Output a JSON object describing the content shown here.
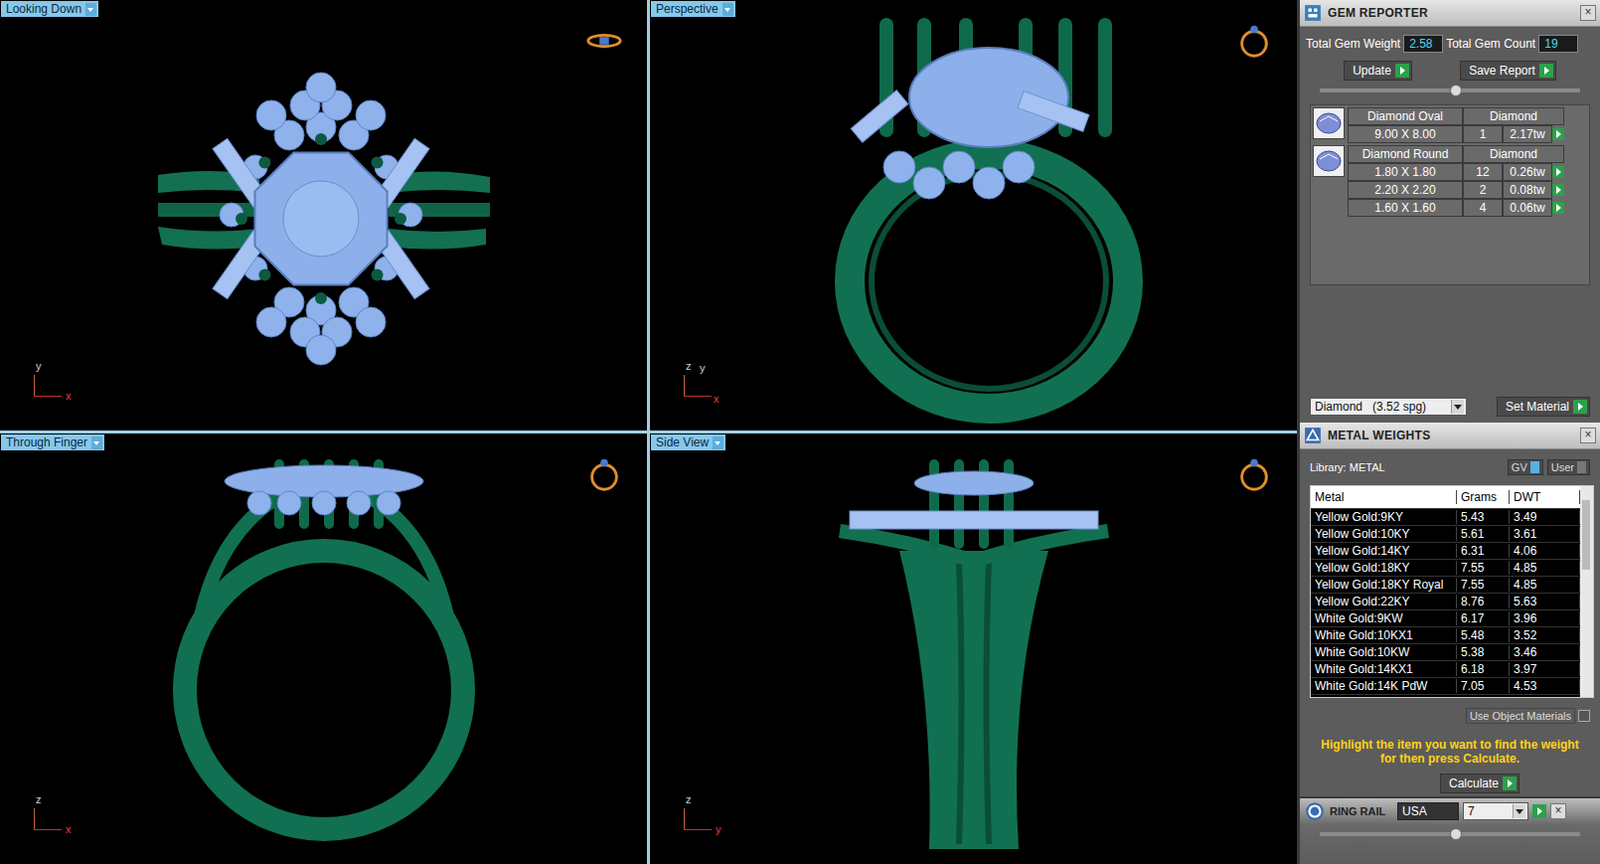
{
  "viewports": [
    {
      "label": "Looking Down",
      "view": "top",
      "axes": [
        "y",
        "x"
      ]
    },
    {
      "label": "Perspective",
      "view": "perspective",
      "axes": [
        "z",
        "y",
        "x"
      ]
    },
    {
      "label": "Through Finger",
      "view": "front",
      "axes": [
        "z",
        "x"
      ]
    },
    {
      "label": "Side View",
      "view": "side",
      "axes": [
        "z",
        "y"
      ]
    }
  ],
  "gem_reporter": {
    "title": "GEM REPORTER",
    "close": "×",
    "total_weight_label": "Total Gem Weight",
    "total_weight": "2.58",
    "total_count_label": "Total Gem Count",
    "total_count": "19",
    "buttons": [
      "Update",
      "Save Report"
    ],
    "groups": [
      {
        "name": "Diamond Oval",
        "material": "Diamond",
        "rows": [
          {
            "size": "9.00 X 8.00",
            "count": "1",
            "weight": "2.17tw"
          }
        ]
      },
      {
        "name": "Diamond Round",
        "material": "Diamond",
        "rows": [
          {
            "size": "1.80 X 1.80",
            "count": "12",
            "weight": "0.26tw"
          },
          {
            "size": "2.20 X 2.20",
            "count": "2",
            "weight": "0.08tw"
          },
          {
            "size": "1.60 X 1.60",
            "count": "4",
            "weight": "0.06tw"
          }
        ]
      }
    ],
    "material_select": "Diamond   (3.52 spg)",
    "set_material": "Set Material"
  },
  "metal_weights": {
    "title": "METAL WEIGHTS",
    "close": "×",
    "library": "Library: METAL",
    "toggles": [
      {
        "label": "GV",
        "on": true
      },
      {
        "label": "User",
        "on": false
      }
    ],
    "columns": [
      "Metal",
      "Grams",
      "DWT"
    ],
    "rows": [
      [
        "Yellow Gold:9KY",
        "5.43",
        "3.49"
      ],
      [
        "Yellow Gold:10KY",
        "5.61",
        "3.61"
      ],
      [
        "Yellow Gold:14KY",
        "6.31",
        "4.06"
      ],
      [
        "Yellow Gold:18KY",
        "7.55",
        "4.85"
      ],
      [
        "Yellow Gold:18KY Royal",
        "7.55",
        "4.85"
      ],
      [
        "Yellow Gold:22KY",
        "8.76",
        "5.63"
      ],
      [
        "White Gold:9KW",
        "6.17",
        "3.96"
      ],
      [
        "White Gold:10KX1",
        "5.48",
        "3.52"
      ],
      [
        "White Gold:10KW",
        "5.38",
        "3.46"
      ],
      [
        "White Gold:14KX1",
        "6.18",
        "3.97"
      ],
      [
        "White Gold:14K PdW",
        "7.05",
        "4.53"
      ]
    ],
    "use_object_materials": "Use Object Materials",
    "hint": "Highlight the item you want to find the weight for then press Calculate.",
    "calculate": "Calculate"
  },
  "ring_rail": {
    "title": "RING RAIL",
    "close": "×",
    "standard": "USA",
    "size": "7"
  }
}
